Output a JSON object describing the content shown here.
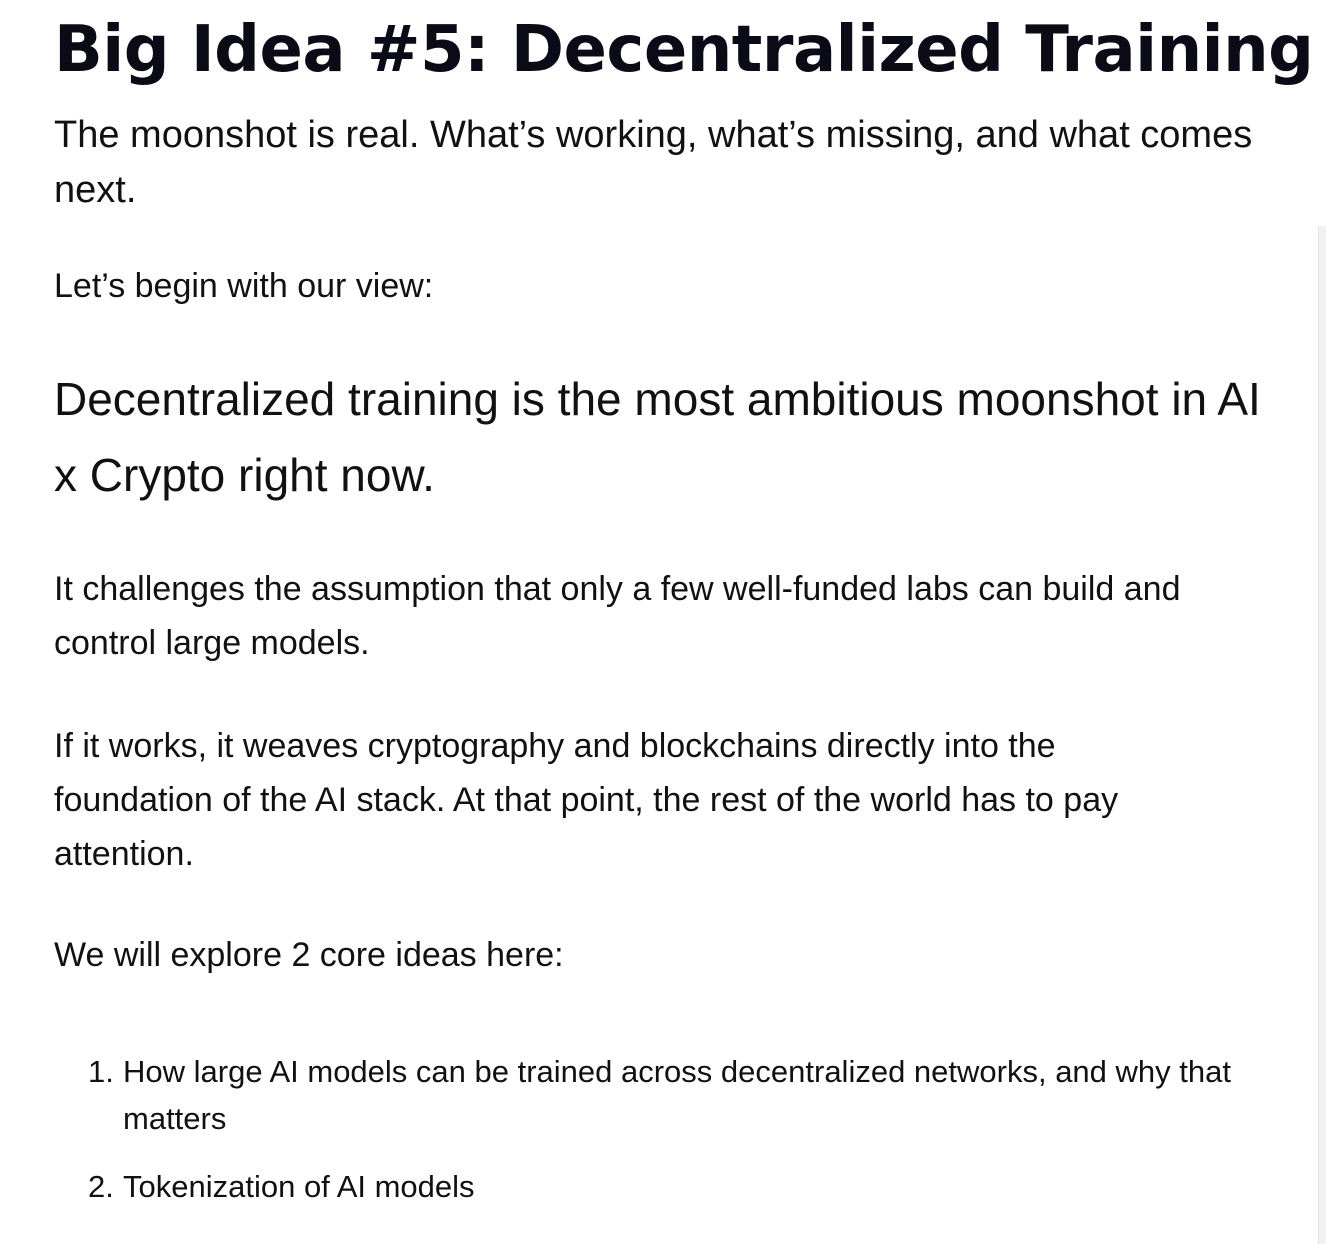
{
  "article": {
    "title": "Big Idea #5: Decentralized Training",
    "subtitle": "The moonshot is real. What’s working, what’s missing, and what comes next.",
    "intro": "Let’s begin with our view:",
    "lead": "Decentralized training is the most ambitious moonshot in AI x Crypto right now.",
    "paragraphs": [
      "It challenges the assumption that only a few well-funded labs can build and control large models.",
      "If it works, it weaves cryptography and blockchains directly into the foundation of the AI stack. At that point, the rest of the world has to pay attention.",
      "We will explore 2 core ideas here:"
    ],
    "list": [
      {
        "num": "1.",
        "text": "How large AI models can be trained across decentralized networks, and why that matters"
      },
      {
        "num": "2.",
        "text": "Tokenization of AI models"
      }
    ]
  }
}
